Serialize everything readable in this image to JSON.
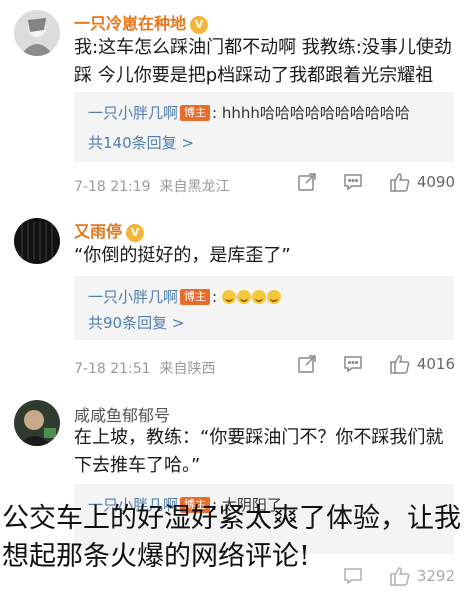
{
  "comments": [
    {
      "user": "一只冷崽在种地",
      "badge_icon": "vip-badge-icon",
      "text": "我:这车怎么踩油门都不动啊 我教练:没事儿使劲踩 今儿你要是把p档踩动了我都跟着光宗耀祖",
      "reply": {
        "author": "一只小胖几啊",
        "tag": "博主",
        "text": ": hhhh哈哈哈哈哈哈哈哈哈哈"
      },
      "reply_count": "共140条回复 >",
      "date": "7-18 21:19",
      "location": "来自黑龙江",
      "likes": "4090"
    },
    {
      "user": "又雨停",
      "badge_icon": "vip-badge-icon",
      "text": "“你倒的挺好的，是库歪了”",
      "reply": {
        "author": "一只小胖几啊",
        "tag": "博主",
        "text": ":"
      },
      "reply_count": "共90条回复 >",
      "date": "7-18 21:51",
      "location": "来自陕西",
      "likes": "4016"
    },
    {
      "user": "咸咸鱼郁郁号",
      "text": "在上坡，教练：“你要踩油门不？你不踩我们就下去推车了哈。”",
      "reply": {
        "author": "一只小胖几啊",
        "tag": "博主",
        "text": ": 太阴阳了"
      },
      "likes": "3292"
    }
  ],
  "overlay_caption": "公交车上的好湿好紧太爽了体验，让我想起那条火爆的网络评论!"
}
